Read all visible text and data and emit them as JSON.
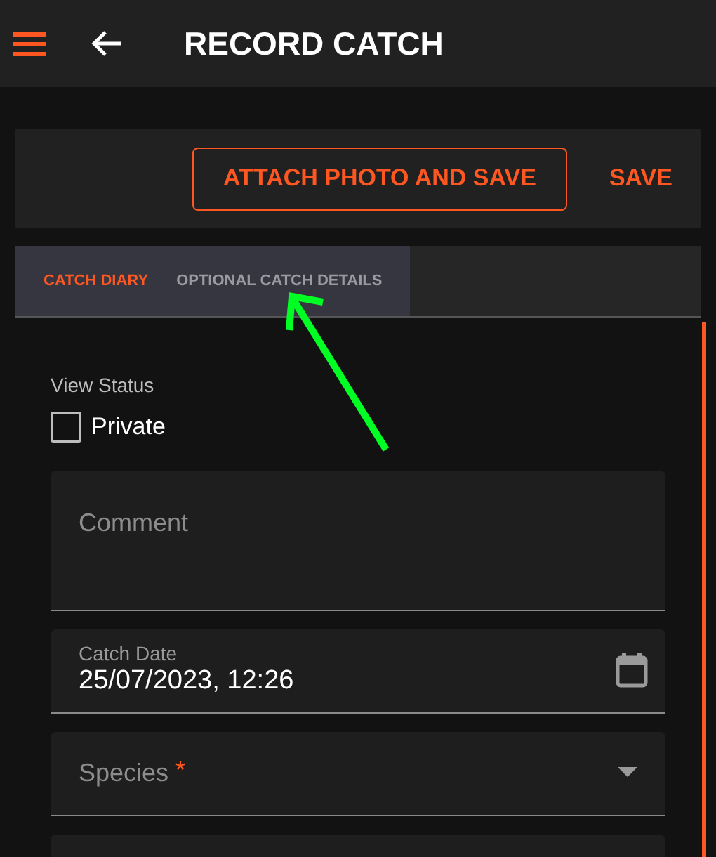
{
  "header": {
    "title": "RECORD CATCH"
  },
  "actions": [
    {
      "label": "ATTACH PHOTO AND SAVE",
      "kind": "outlined"
    },
    {
      "label": "SAVE",
      "kind": "text"
    }
  ],
  "tabs": [
    {
      "label": "CATCH DIARY",
      "selected": true
    },
    {
      "label": "OPTIONAL CATCH DETAILS",
      "selected": false
    }
  ],
  "view_status": {
    "label": "View Status",
    "checkbox": {
      "label": "Private",
      "checked": false
    }
  },
  "fields": [
    {
      "kind": "textarea",
      "placeholder": "Comment"
    },
    {
      "kind": "date",
      "label": "Catch Date",
      "value": "25/07/2023, 12:26"
    },
    {
      "kind": "select",
      "placeholder": "Species",
      "required_mark": "*"
    },
    {
      "kind": "blank"
    }
  ]
}
